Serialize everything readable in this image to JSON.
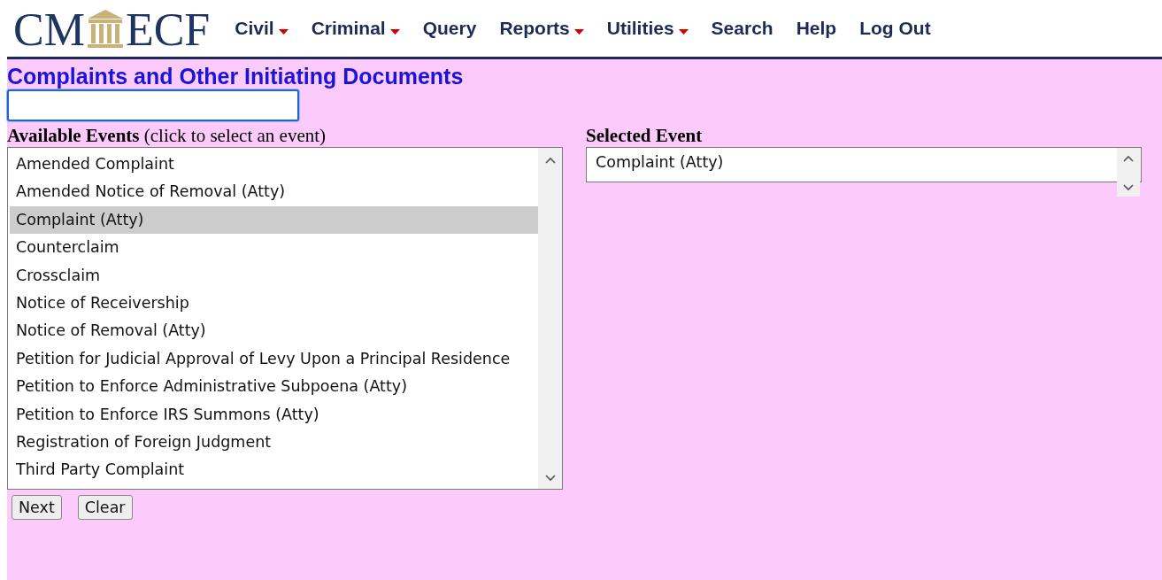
{
  "header": {
    "logo": {
      "left": "CM",
      "right": "ECF"
    },
    "menu": [
      {
        "label": "Civil",
        "has_menu": true
      },
      {
        "label": "Criminal",
        "has_menu": true
      },
      {
        "label": "Query",
        "has_menu": false
      },
      {
        "label": "Reports",
        "has_menu": true
      },
      {
        "label": "Utilities",
        "has_menu": true
      },
      {
        "label": "Search",
        "has_menu": false
      },
      {
        "label": "Help",
        "has_menu": false
      },
      {
        "label": "Log Out",
        "has_menu": false
      }
    ]
  },
  "page": {
    "title": "Complaints and Other Initiating Documents",
    "filter_field": {
      "focused": true
    },
    "available_events": {
      "label": "Available Events",
      "hint": "(click to select an event)",
      "items": [
        {
          "label": "Amended Complaint",
          "selected": false
        },
        {
          "label": "Amended Notice of Removal (Atty)",
          "selected": false
        },
        {
          "label": "Complaint (Atty)",
          "selected": true
        },
        {
          "label": "Counterclaim",
          "selected": false
        },
        {
          "label": "Crossclaim",
          "selected": false
        },
        {
          "label": "Notice of Receivership",
          "selected": false
        },
        {
          "label": "Notice of Removal (Atty)",
          "selected": false
        },
        {
          "label": "Petition for Judicial Approval of Levy Upon a Principal Residence",
          "selected": false
        },
        {
          "label": "Petition to Enforce Administrative Subpoena (Atty)",
          "selected": false
        },
        {
          "label": "Petition to Enforce IRS Summons (Atty)",
          "selected": false
        },
        {
          "label": "Registration of Foreign Judgment",
          "selected": false
        },
        {
          "label": "Third Party Complaint",
          "selected": false
        }
      ]
    },
    "selected_event": {
      "label": "Selected Event",
      "items": [
        "Complaint (Atty)"
      ]
    },
    "buttons": [
      "Next",
      "Clear"
    ]
  }
}
